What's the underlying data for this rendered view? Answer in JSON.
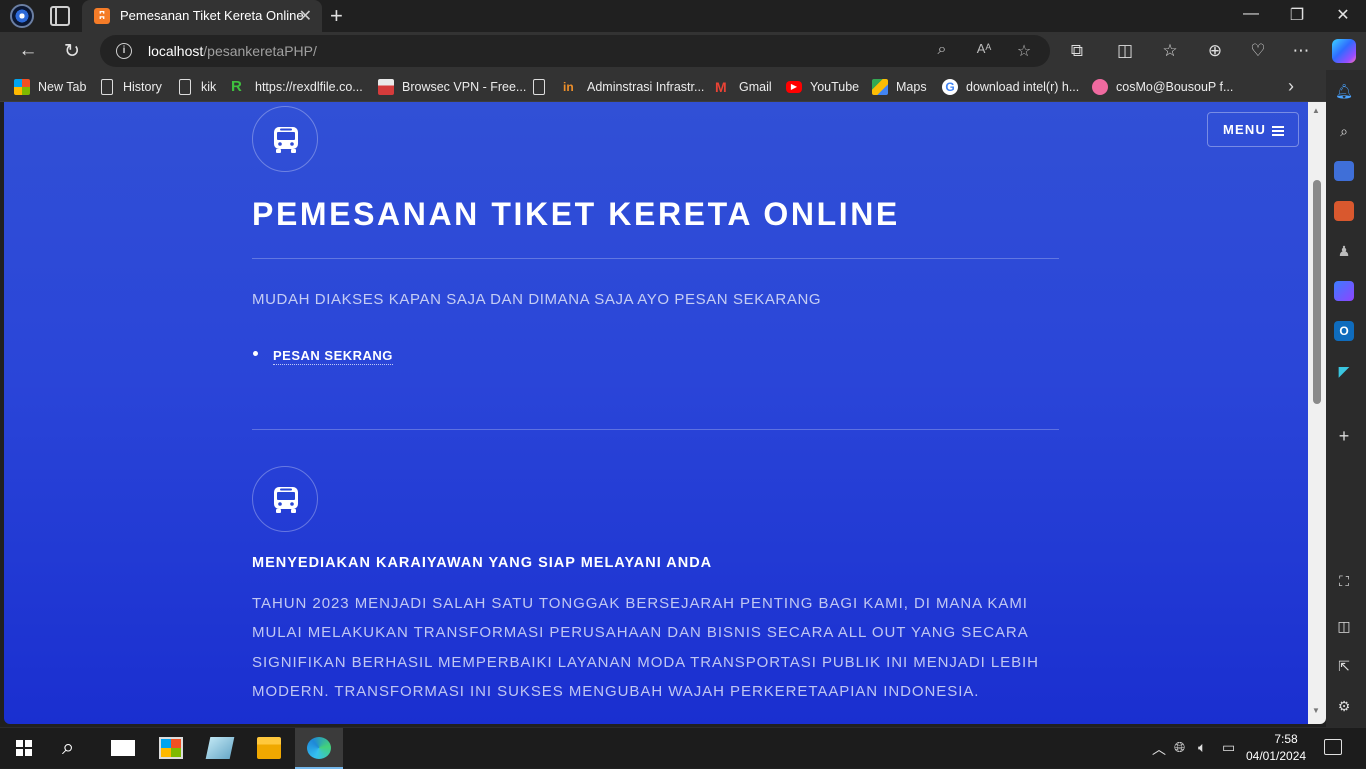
{
  "browser": {
    "tab": {
      "title": "Pemesanan Tiket Kereta Online",
      "favicon": "xampp-icon"
    },
    "address": {
      "host": "localhost",
      "path": "/pesankeretaPHP/"
    },
    "bookmarks": [
      {
        "label": "New Tab",
        "icon": "grid-icon"
      },
      {
        "label": "History",
        "icon": "page-icon"
      },
      {
        "label": "kik",
        "icon": "page-icon"
      },
      {
        "label": "https://rexdlfile.co...",
        "icon": "r-icon"
      },
      {
        "label": "Browsec VPN - Free...",
        "icon": "browsec-icon"
      },
      {
        "label": "",
        "icon": "page-icon"
      },
      {
        "label": "Adminstrasi Infrastr...",
        "icon": "in-icon"
      },
      {
        "label": "Gmail",
        "icon": "gmail-icon"
      },
      {
        "label": "YouTube",
        "icon": "youtube-icon"
      },
      {
        "label": "Maps",
        "icon": "maps-icon"
      },
      {
        "label": "download intel(r) h...",
        "icon": "google-icon"
      },
      {
        "label": "cosMo@BousouP f...",
        "icon": "cosmo-icon"
      }
    ]
  },
  "site": {
    "menu_label": "MENU",
    "title": "PEMESANAN TIKET KERETA ONLINE",
    "tagline": "MUDAH DIAKSES KAPAN SAJA DAN DIMANA SAJA AYO PESAN SEKARANG",
    "cta_label": "PESAN SEKRANG",
    "feature": {
      "title": "MENYEDIAKAN KARAIYAWAN YANG SIAP MELAYANI ANDA",
      "body_lines": [
        "TAHUN 2023 MENJADI SALAH SATU TONGGAK BERSEJARAH PENTING BAGI KAMI, DI MANA KAMI",
        "MULAI MELAKUKAN TRANSFORMASI PERUSAHAAN DAN BISNIS SECARA ALL OUT YANG SECARA",
        "SIGNIFIKAN BERHASIL MEMPERBAIKI LAYANAN MODA TRANSPORTASI PUBLIK INI MENJADI LEBIH",
        "MODERN. TRANSFORMASI INI SUKSES MENGUBAH WAJAH PERKERETAAPIAN INDONESIA."
      ]
    },
    "colors": {
      "page_top": "#3150d6",
      "page_bottom": "#1a2fd0",
      "text": "#ffffff"
    }
  },
  "taskbar": {
    "time": "7:58",
    "date": "04/01/2024"
  }
}
